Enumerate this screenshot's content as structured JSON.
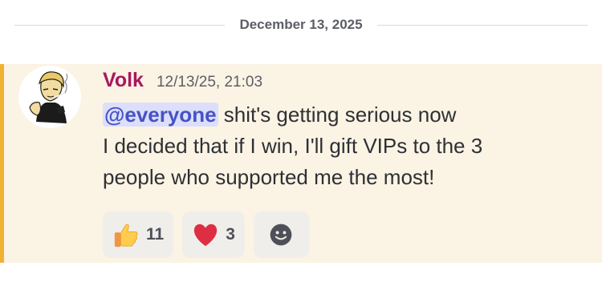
{
  "divider": {
    "date": "December 13, 2025"
  },
  "message": {
    "username": "Volk",
    "timestamp": "12/13/25, 21:03",
    "mention": "@everyone",
    "line1_rest": " shit's getting serious now",
    "line2": "I decided that if I win, I'll gift VIPs to the 3",
    "line3": "people who supported me the most!",
    "reactions": [
      {
        "emoji": "thumbs-up",
        "count": "11"
      },
      {
        "emoji": "red-heart",
        "count": "3"
      }
    ],
    "add_reaction_icon": "smiley-face-icon"
  },
  "colors": {
    "mention_highlight_bg": "#fbf3e4",
    "mention_bar": "#f0b232",
    "username": "#a8175e",
    "mention_text": "#4752c4"
  }
}
